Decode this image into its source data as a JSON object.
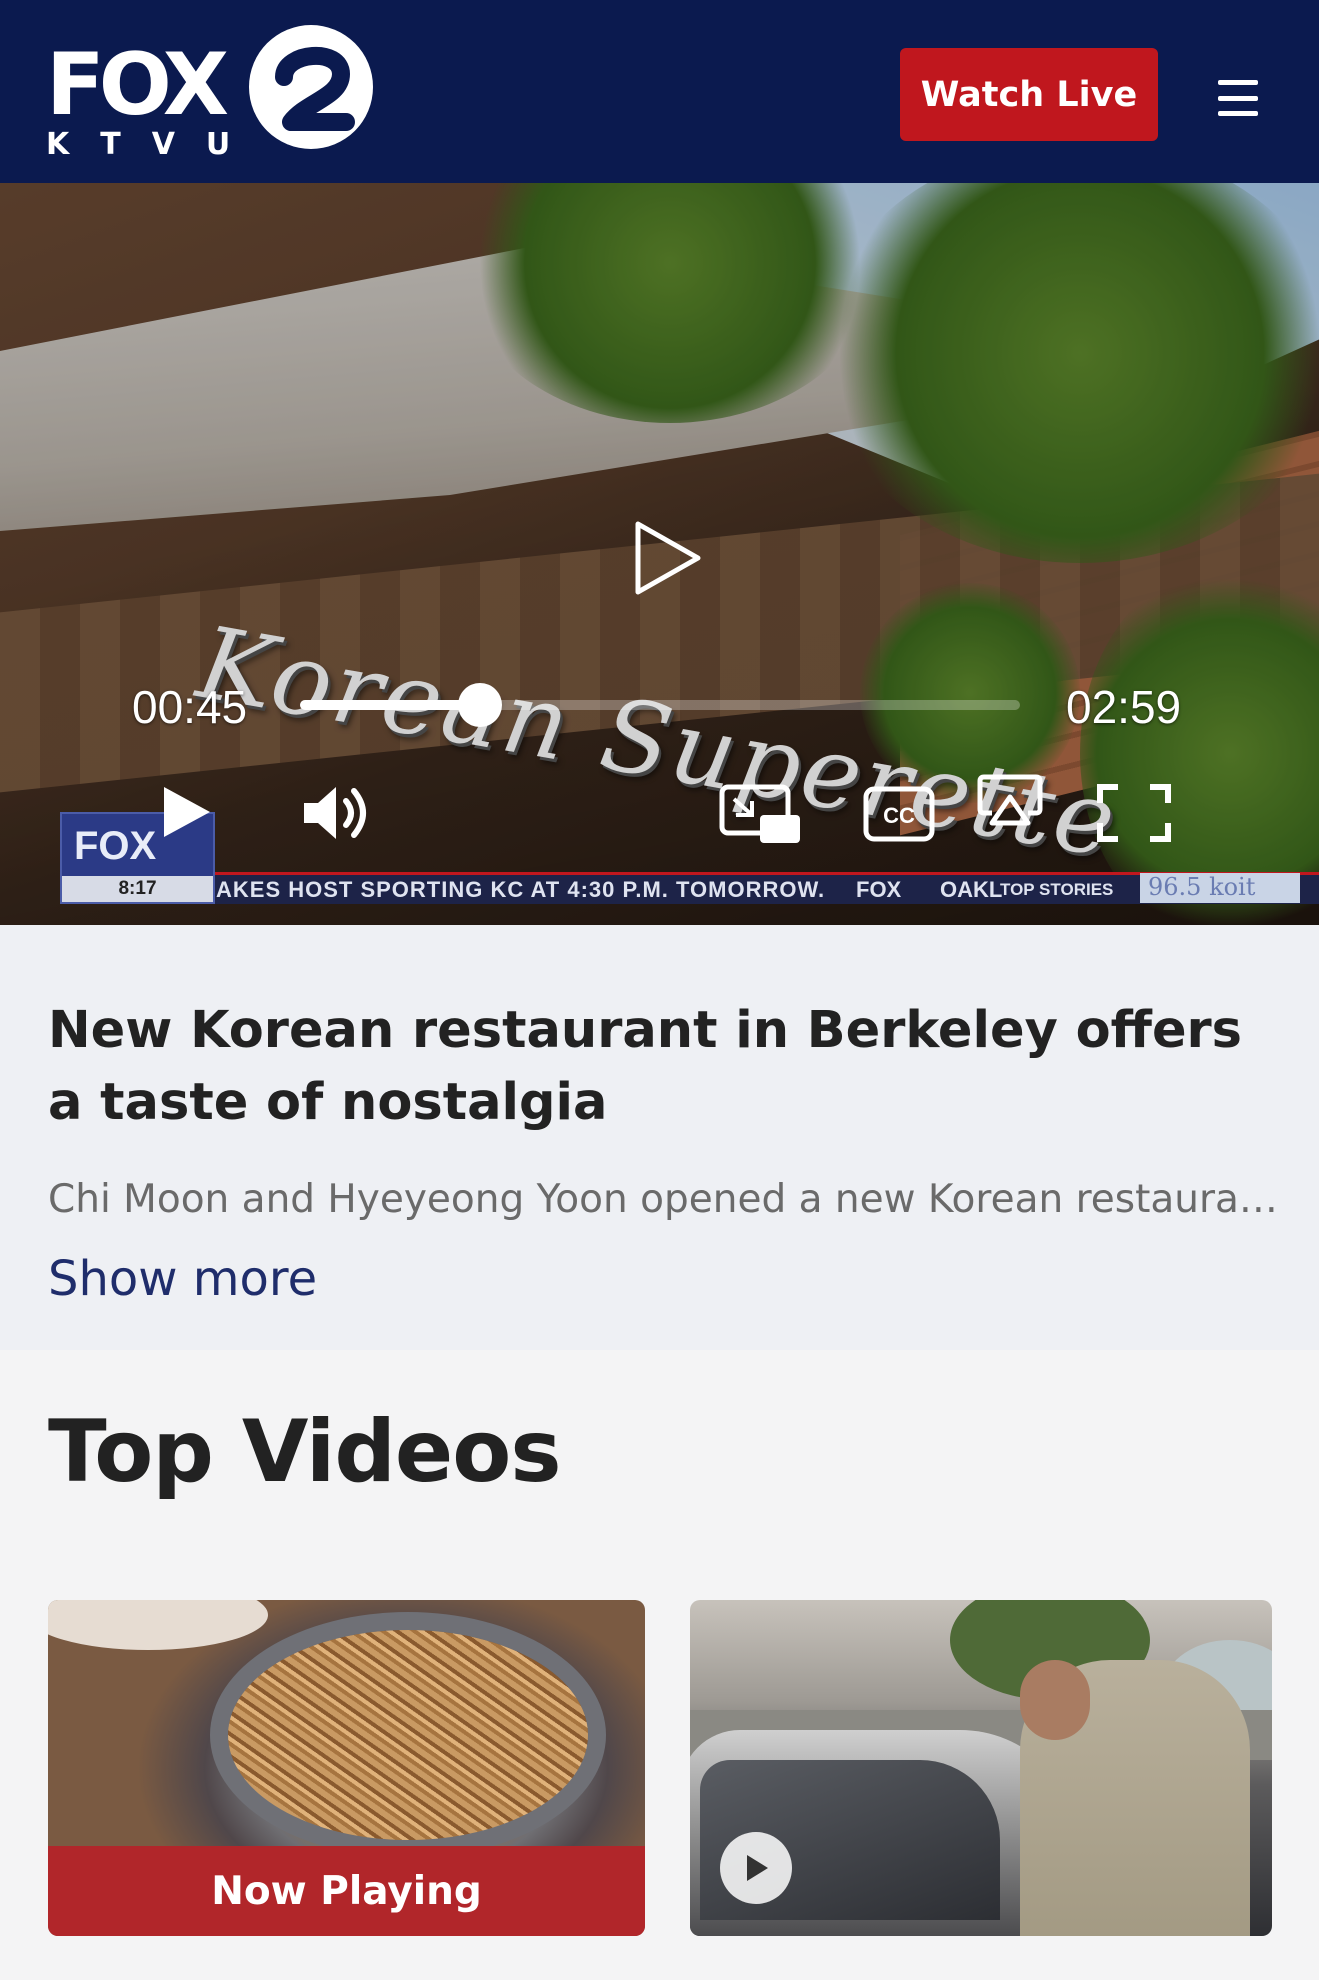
{
  "header": {
    "logo_text": "FOX",
    "logo_number": "2",
    "logo_sub": "KTVU",
    "watch_live_label": "Watch Live",
    "menu_icon": "hamburger-menu-icon"
  },
  "video": {
    "sign_text": "Korean Superette",
    "time_current": "00:45",
    "time_total": "02:59",
    "progress": 0.25,
    "controls": [
      "play-icon",
      "volume-icon",
      "picture-in-picture-icon",
      "closed-captions-icon",
      "airplay-icon",
      "fullscreen-icon"
    ],
    "cc_label": "CC",
    "lower_third": {
      "bug_text": "FOX",
      "bug_time": "8:17",
      "ticker": "AKES HOST SPORTING KC AT 4:30 P.M. TOMORROW.",
      "ticker_fox": "FOX",
      "ticker_city": "OAKL",
      "ticker_section": "TOP STORIES",
      "radio": "96.5 koit"
    }
  },
  "article": {
    "headline": "New Korean restaurant in Berkeley offers a taste of nostalgia",
    "summary": "Chi Moon and Hyeyeong Yoon opened a new Korean restaurant a...",
    "show_more_label": "Show more"
  },
  "top_videos": {
    "heading": "Top Videos",
    "cards": [
      {
        "status_label": "Now Playing"
      },
      {
        "status_label": ""
      }
    ]
  },
  "colors": {
    "header_bg": "#0b1a4f",
    "accent_red": "#c0171e",
    "link_blue": "#1f2d6b"
  }
}
